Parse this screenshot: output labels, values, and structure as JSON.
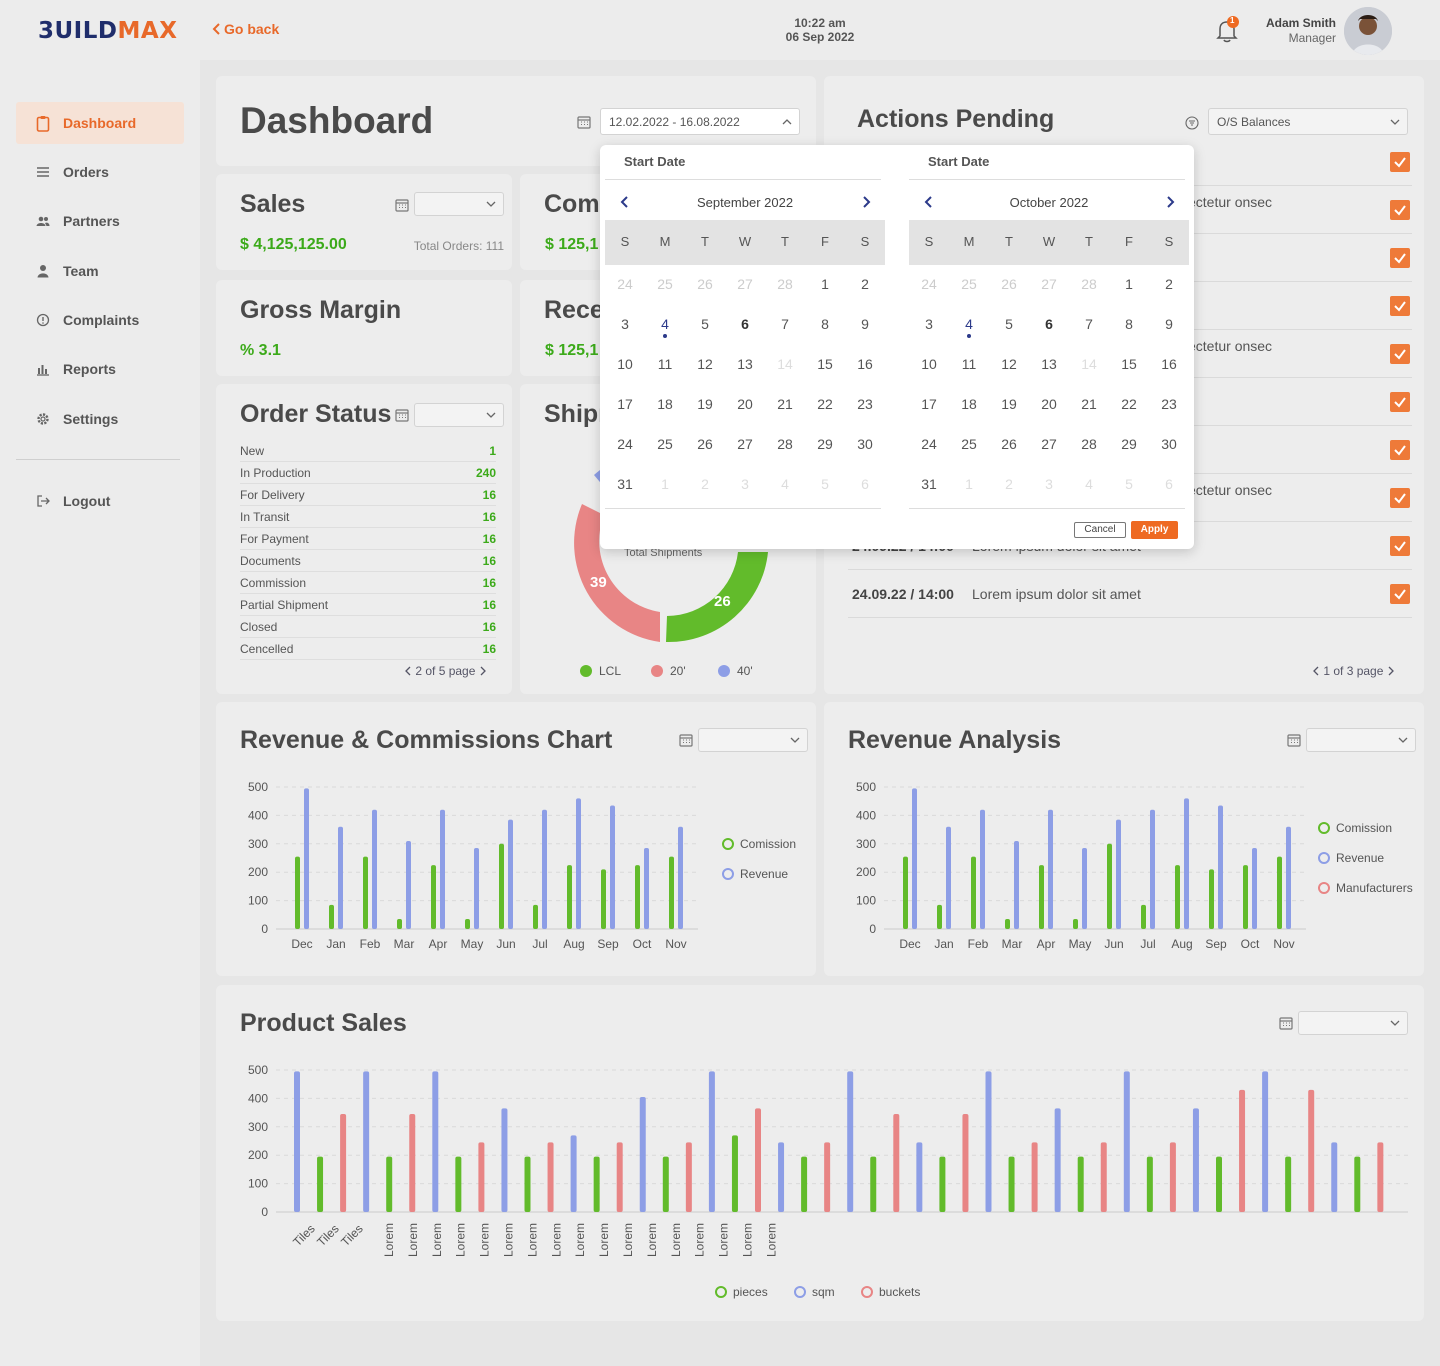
{
  "brand": {
    "part1": "3UILD",
    "part2": "MAX",
    "accent": "#e8692a",
    "navy": "#1f2d6b"
  },
  "header": {
    "back_label": "Go back",
    "time": "10:22 am",
    "date": "06 Sep 2022",
    "notification_count": "1",
    "user_name": "Adam Smith",
    "user_role": "Manager"
  },
  "sidebar": {
    "items": [
      {
        "label": "Dashboard",
        "icon": "clipboard-icon",
        "active": true
      },
      {
        "label": "Orders",
        "icon": "list-icon"
      },
      {
        "label": "Partners",
        "icon": "users-icon"
      },
      {
        "label": "Team",
        "icon": "person-icon"
      },
      {
        "label": "Complaints",
        "icon": "alert-circle-icon"
      },
      {
        "label": "Reports",
        "icon": "bar-chart-icon"
      },
      {
        "label": "Settings",
        "icon": "gear-icon"
      }
    ],
    "logout": "Logout"
  },
  "dashboard": {
    "title": "Dashboard",
    "date_range": "12.02.2022 - 16.08.2022"
  },
  "sales": {
    "title": "Sales",
    "value": "$ 4,125,125.00",
    "total_orders": "Total Orders: 111"
  },
  "commission": {
    "title": "Comm",
    "value": "$ 125,1"
  },
  "gross_margin": {
    "title": "Gross Margin",
    "value": "% 3.1"
  },
  "receivables": {
    "title": "Rece",
    "value": "$ 125,1"
  },
  "order_status": {
    "title": "Order Status",
    "pager": "2 of 5 page",
    "rows": [
      {
        "label": "New",
        "value": "1"
      },
      {
        "label": "In Production",
        "value": "240"
      },
      {
        "label": "For Delivery",
        "value": "16"
      },
      {
        "label": "In Transit",
        "value": "16"
      },
      {
        "label": "For Payment",
        "value": "16"
      },
      {
        "label": "Documents",
        "value": "16"
      },
      {
        "label": "Commission",
        "value": "16"
      },
      {
        "label": "Partial Shipment",
        "value": "16"
      },
      {
        "label": "Closed",
        "value": "16"
      },
      {
        "label": "Cencelled",
        "value": "16"
      }
    ]
  },
  "shipments": {
    "title": "Shipı",
    "center_label": "Total Shipments",
    "slices": [
      {
        "label": "LCL",
        "value": 26,
        "color": "#62bb2b"
      },
      {
        "label": "20'",
        "value": 39,
        "color": "#e88585"
      },
      {
        "label": "40'",
        "value": 6,
        "color": "#8d9ee6"
      }
    ]
  },
  "actions": {
    "title": "Actions Pending",
    "filter": "O/S Balances",
    "pager": "1 of 3 page",
    "rows": [
      {
        "text": ""
      },
      {
        "text": "ectetur onsec"
      },
      {
        "text": ""
      },
      {
        "text": ""
      },
      {
        "text": "ectetur onsec"
      },
      {
        "text": ""
      },
      {
        "text": ""
      },
      {
        "text": "ectetur onsec"
      },
      {
        "text": "24.09.22 / 14:00",
        "desc": "Lorem ipsum dolor sit amet"
      },
      {
        "text": "24.09.22 / 14:00",
        "desc": "Lorem ipsum dolor sit amet"
      }
    ]
  },
  "datepicker": {
    "left": {
      "title": "Start Date",
      "month": "September  2022"
    },
    "right": {
      "title": "Start Date",
      "month": "October  2022"
    },
    "weekdays": [
      "S",
      "M",
      "T",
      "W",
      "T",
      "F",
      "S"
    ],
    "cancel": "Cancel",
    "apply": "Apply"
  },
  "rev_chart": {
    "title": "Revenue & Commissions Chart"
  },
  "rev_analysis": {
    "title": "Revenue Analysis"
  },
  "product_sales": {
    "title": "Product Sales"
  },
  "chart_data": [
    {
      "type": "bar",
      "title": "Revenue & Commissions Chart",
      "categories": [
        "Dec",
        "Jan",
        "Feb",
        "Mar",
        "Apr",
        "May",
        "Jun",
        "Jul",
        "Aug",
        "Sep",
        "Oct",
        "Nov"
      ],
      "ylim": [
        0,
        500
      ],
      "yticks": [
        0,
        100,
        200,
        300,
        400,
        500
      ],
      "series": [
        {
          "name": "Comission",
          "color": "#62bb2b",
          "values": [
            255,
            85,
            255,
            35,
            225,
            35,
            300,
            85,
            225,
            210,
            225,
            255
          ]
        },
        {
          "name": "Revenue",
          "color": "#8d9ee6",
          "values": [
            495,
            360,
            420,
            310,
            420,
            285,
            385,
            420,
            460,
            435,
            285,
            360
          ]
        }
      ]
    },
    {
      "type": "bar",
      "title": "Revenue Analysis",
      "categories": [
        "Dec",
        "Jan",
        "Feb",
        "Mar",
        "Apr",
        "May",
        "Jun",
        "Jul",
        "Aug",
        "Sep",
        "Oct",
        "Nov"
      ],
      "ylim": [
        0,
        500
      ],
      "yticks": [
        0,
        100,
        200,
        300,
        400,
        500
      ],
      "series": [
        {
          "name": "Comission",
          "color": "#62bb2b",
          "values": [
            255,
            85,
            255,
            35,
            225,
            35,
            300,
            85,
            225,
            210,
            225,
            255
          ]
        },
        {
          "name": "Revenue",
          "color": "#8d9ee6",
          "values": [
            495,
            360,
            420,
            310,
            420,
            285,
            385,
            420,
            460,
            435,
            285,
            360
          ]
        },
        {
          "name": "Manufacturers",
          "color": "#e88585",
          "values": []
        }
      ]
    },
    {
      "type": "bar",
      "title": "Product Sales",
      "categories": [
        "Tiles",
        "Tiles",
        "Tiles",
        "Lorem",
        "Lorem",
        "Lorem",
        "Lorem",
        "Lorem",
        "Lorem",
        "Lorem",
        "Lorem",
        "Lorem",
        "Lorem",
        "Lorem",
        "Lorem",
        "Lorem",
        "Lorem",
        "Lorem",
        "Lorem",
        "Lorem"
      ],
      "ylim": [
        0,
        500
      ],
      "yticks": [
        0,
        100,
        200,
        300,
        400,
        500
      ],
      "series": [
        {
          "name": "pieces",
          "color": "#62bb2b"
        },
        {
          "name": "sqm",
          "color": "#8d9ee6"
        },
        {
          "name": "buckets",
          "color": "#e88585"
        }
      ],
      "bars": [
        {
          "s": 1,
          "v": 495
        },
        {
          "s": 0,
          "v": 195
        },
        {
          "s": 2,
          "v": 345
        },
        {
          "s": 1,
          "v": 495
        },
        {
          "s": 0,
          "v": 195
        },
        {
          "s": 2,
          "v": 345
        },
        {
          "s": 1,
          "v": 495
        },
        {
          "s": 0,
          "v": 195
        },
        {
          "s": 2,
          "v": 245
        },
        {
          "s": 1,
          "v": 365
        },
        {
          "s": 0,
          "v": 195
        },
        {
          "s": 2,
          "v": 245
        },
        {
          "s": 1,
          "v": 270
        },
        {
          "s": 0,
          "v": 195
        },
        {
          "s": 2,
          "v": 245
        },
        {
          "s": 1,
          "v": 405
        },
        {
          "s": 0,
          "v": 195
        },
        {
          "s": 2,
          "v": 245
        },
        {
          "s": 1,
          "v": 495
        },
        {
          "s": 0,
          "v": 270
        },
        {
          "s": 2,
          "v": 365
        },
        {
          "s": 1,
          "v": 245
        },
        {
          "s": 0,
          "v": 195
        },
        {
          "s": 2,
          "v": 245
        },
        {
          "s": 1,
          "v": 495
        },
        {
          "s": 0,
          "v": 195
        },
        {
          "s": 2,
          "v": 345
        },
        {
          "s": 1,
          "v": 245
        },
        {
          "s": 0,
          "v": 195
        },
        {
          "s": 2,
          "v": 345
        },
        {
          "s": 1,
          "v": 495
        },
        {
          "s": 0,
          "v": 195
        },
        {
          "s": 2,
          "v": 245
        },
        {
          "s": 1,
          "v": 365
        },
        {
          "s": 0,
          "v": 195
        },
        {
          "s": 2,
          "v": 245
        },
        {
          "s": 1,
          "v": 495
        },
        {
          "s": 0,
          "v": 195
        },
        {
          "s": 2,
          "v": 245
        },
        {
          "s": 1,
          "v": 365
        },
        {
          "s": 0,
          "v": 195
        },
        {
          "s": 2,
          "v": 430
        },
        {
          "s": 1,
          "v": 495
        },
        {
          "s": 0,
          "v": 195
        },
        {
          "s": 2,
          "v": 430
        },
        {
          "s": 1,
          "v": 245
        },
        {
          "s": 0,
          "v": 195
        },
        {
          "s": 2,
          "v": 245
        }
      ]
    }
  ]
}
